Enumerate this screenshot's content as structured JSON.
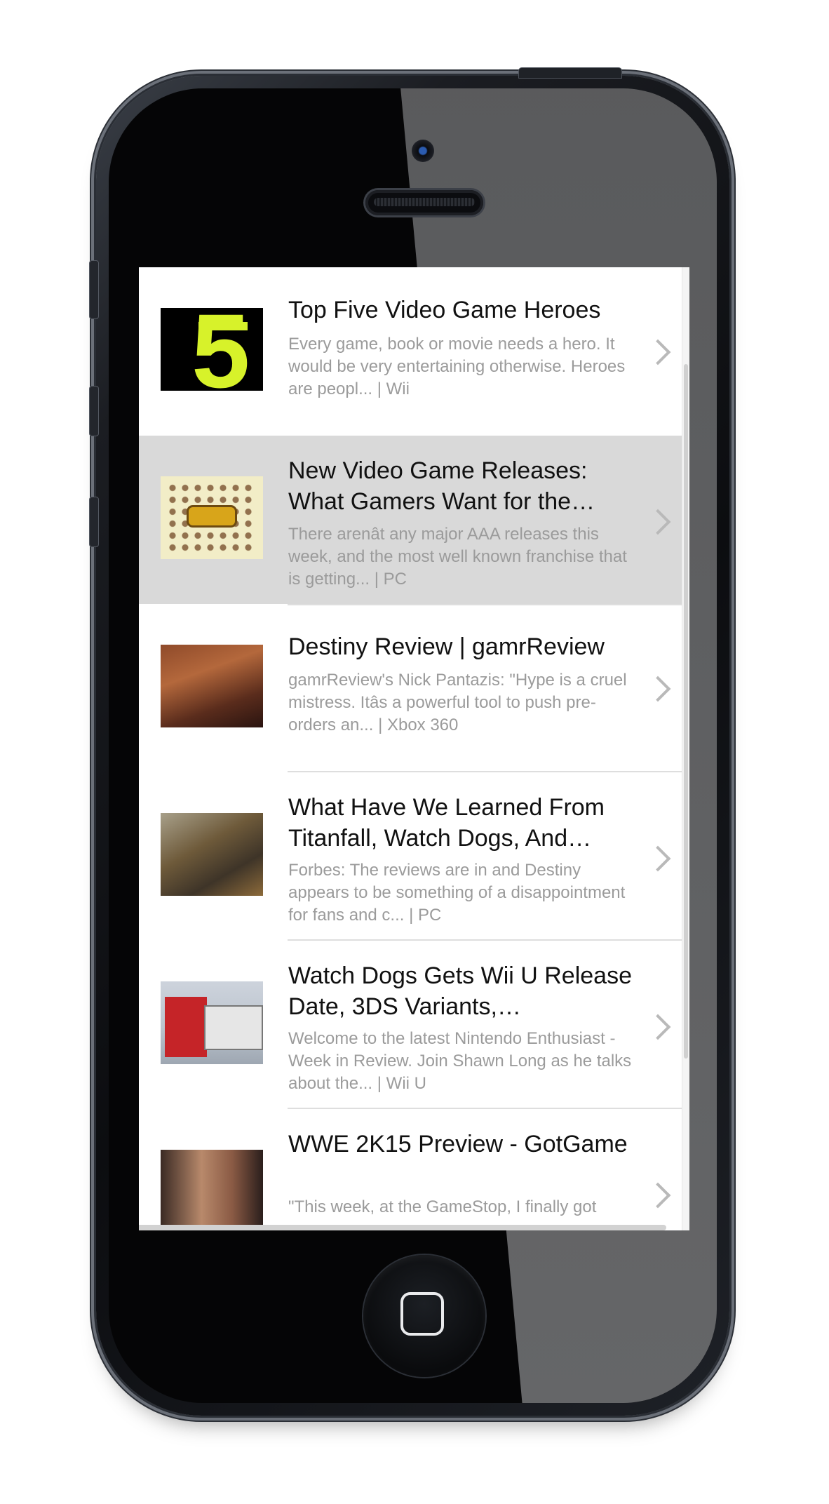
{
  "device": {
    "name": "iPhone"
  },
  "feed": {
    "items": [
      {
        "title": "Top Five Video Game Heroes",
        "description": "Every game, book or movie needs a hero. It would be very entertaining otherwise. Heroes are peopl... | Wii",
        "thumbnail": "top-five-heroes-thumbnail"
      },
      {
        "title": "New Video Game Releases: What Gamers Want for the…",
        "description": "There arenât any major AAA releases this week, and the most well known franchise that is getting... | PC",
        "thumbnail": "game-releases-thumbnail"
      },
      {
        "title": "Destiny Review | gamrReview",
        "description": "gamrReview's Nick Pantazis: \"Hype is a cruel mistress. Itâs a powerful tool to push pre-orders an... | Xbox 360",
        "thumbnail": "destiny-review-thumbnail"
      },
      {
        "title": "What Have We Learned From Titanfall, Watch Dogs, And…",
        "description": "Forbes: The reviews are in and Destiny appears to be something of a disappointment for fans and c... | PC",
        "thumbnail": "destiny-artwork-thumbnail"
      },
      {
        "title": "Watch Dogs Gets Wii U Release Date, 3DS Variants,…",
        "description": "Welcome to the latest Nintendo Enthusiast - Week in Review. Join Shawn Long as he talks about the... | Wii U",
        "thumbnail": "nintendo-3ds-thumbnail"
      },
      {
        "title": "WWE 2K15 Preview - GotGame",
        "description": "\"This week, at the GameStop, I finally got",
        "thumbnail": "wwe-2k15-thumbnail"
      }
    ]
  }
}
